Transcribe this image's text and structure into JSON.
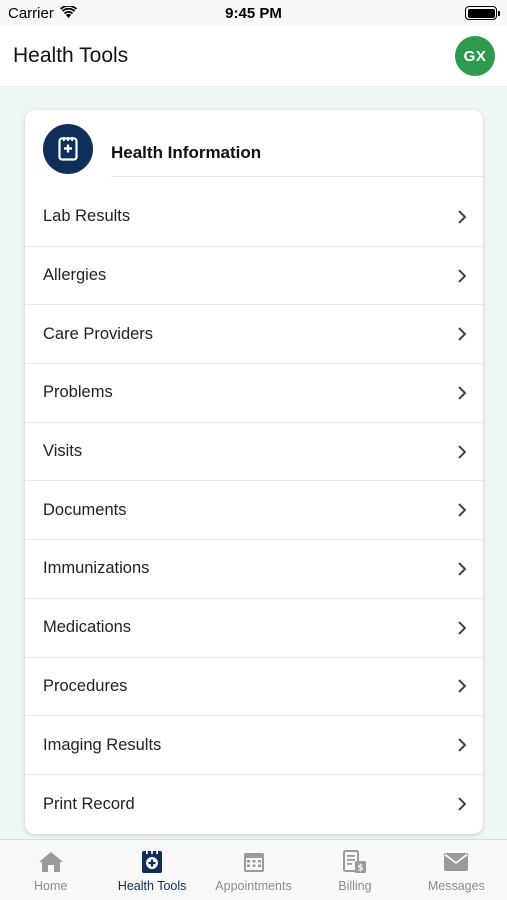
{
  "status_bar": {
    "carrier": "Carrier",
    "time": "9:45 PM"
  },
  "header": {
    "title": "Health Tools",
    "avatar_initials": "GX",
    "avatar_color": "#2e9a4c"
  },
  "card": {
    "title": "Health Information",
    "icon": "medical-record-icon",
    "icon_bg": "#0f2e5a",
    "items": [
      {
        "label": "Lab Results"
      },
      {
        "label": "Allergies"
      },
      {
        "label": "Care Providers"
      },
      {
        "label": "Problems"
      },
      {
        "label": "Visits"
      },
      {
        "label": "Documents"
      },
      {
        "label": "Immunizations"
      },
      {
        "label": "Medications"
      },
      {
        "label": "Procedures"
      },
      {
        "label": "Imaging Results"
      },
      {
        "label": "Print Record"
      }
    ]
  },
  "tab_bar": {
    "active_color": "#0f2e5a",
    "inactive_color": "#8c8c8c",
    "tabs": [
      {
        "label": "Home",
        "icon": "home-icon",
        "active": false
      },
      {
        "label": "Health Tools",
        "icon": "medical-record-icon",
        "active": true
      },
      {
        "label": "Appointments",
        "icon": "calendar-icon",
        "active": false
      },
      {
        "label": "Billing",
        "icon": "billing-icon",
        "active": false
      },
      {
        "label": "Messages",
        "icon": "mail-icon",
        "active": false
      }
    ]
  }
}
